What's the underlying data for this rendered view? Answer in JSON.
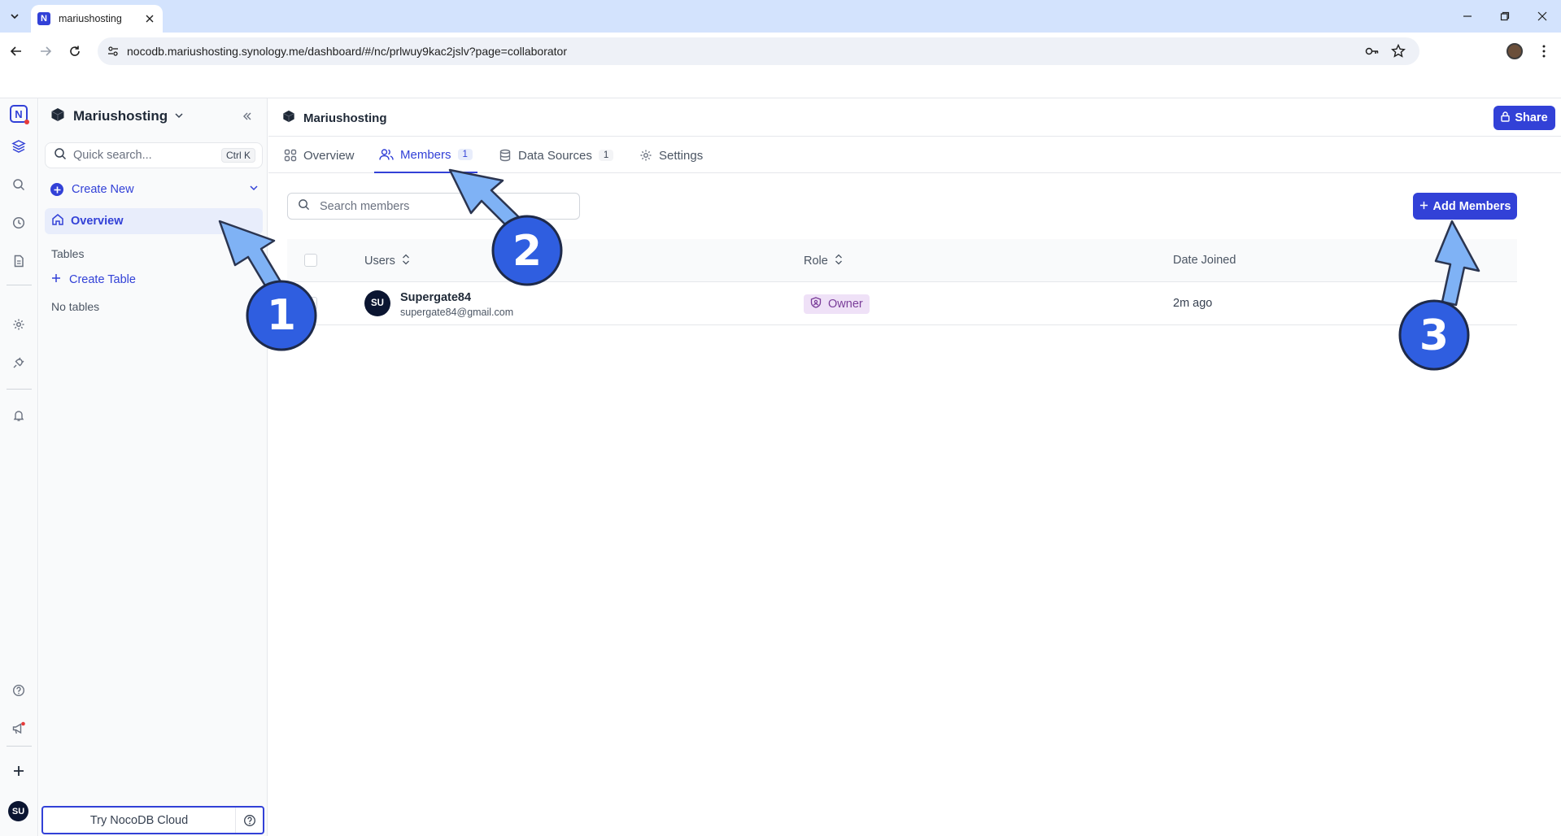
{
  "browser": {
    "tab_title": "mariushosting",
    "favicon_letter": "N",
    "url": "nocodb.mariushosting.synology.me/dashboard/#/nc/prlwuy9kac2jslv?page=collaborator"
  },
  "rail": {
    "logo_letter": "N",
    "avatar_initials": "SU"
  },
  "sidebar": {
    "workspace_name": "Mariushosting",
    "quick_search_placeholder": "Quick search...",
    "quick_search_shortcut": "Ctrl K",
    "create_new_label": "Create New",
    "overview_label": "Overview",
    "tables_heading": "Tables",
    "create_table_label": "Create Table",
    "no_tables_text": "No tables",
    "try_cloud_label": "Try NocoDB Cloud"
  },
  "main": {
    "title": "Mariushosting",
    "share_label": "Share",
    "tabs": [
      {
        "label": "Overview",
        "icon": "grid-icon",
        "badge": ""
      },
      {
        "label": "Members",
        "icon": "users-icon",
        "badge": "1",
        "active": true
      },
      {
        "label": "Data Sources",
        "icon": "database-icon",
        "badge": "1"
      },
      {
        "label": "Settings",
        "icon": "gear-icon",
        "badge": ""
      }
    ],
    "members_search_placeholder": "Search members",
    "add_members_label": "Add Members",
    "table": {
      "columns": [
        "Users",
        "Role",
        "Date Joined"
      ],
      "rows": [
        {
          "initials": "SU",
          "name": "Supergate84",
          "email": "supergate84@gmail.com",
          "role": "Owner",
          "date_joined": "2m ago"
        }
      ]
    }
  },
  "annotations": [
    "1",
    "2",
    "3"
  ],
  "colors": {
    "accent": "#3241d7",
    "annotation_arrow": "#7fb2f5",
    "annotation_circle": "#2f5ee0",
    "owner_badge_bg": "#efe1f7"
  }
}
